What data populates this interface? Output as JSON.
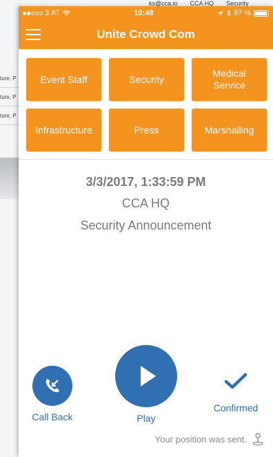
{
  "background": {
    "topbar": [
      "ks@cca.io",
      "CCA HQ",
      "Security"
    ],
    "rows": [
      "ture, P",
      "ture, P",
      "ture, P"
    ]
  },
  "status_bar": {
    "carrier": "3 AT",
    "time": "10:48",
    "battery": "97 %"
  },
  "navbar": {
    "title": "Unite Crowd Com"
  },
  "categories": [
    {
      "label": "Event Staff"
    },
    {
      "label": "Security"
    },
    {
      "label": "Medical Service"
    },
    {
      "label": "Infrastructure"
    },
    {
      "label": "Press"
    },
    {
      "label": "Marshalling"
    }
  ],
  "message": {
    "timestamp": "3/3/2017, 1:33:59 PM",
    "location": "CCA HQ",
    "type": "Security Announcement"
  },
  "actions": {
    "callback_label": "Call Back",
    "play_label": "Play",
    "confirmed_label": "Confirmed"
  },
  "footer": {
    "position_text": "Your position was sent."
  },
  "colors": {
    "accent": "#f5931f",
    "action_blue": "#2f6fb2"
  }
}
